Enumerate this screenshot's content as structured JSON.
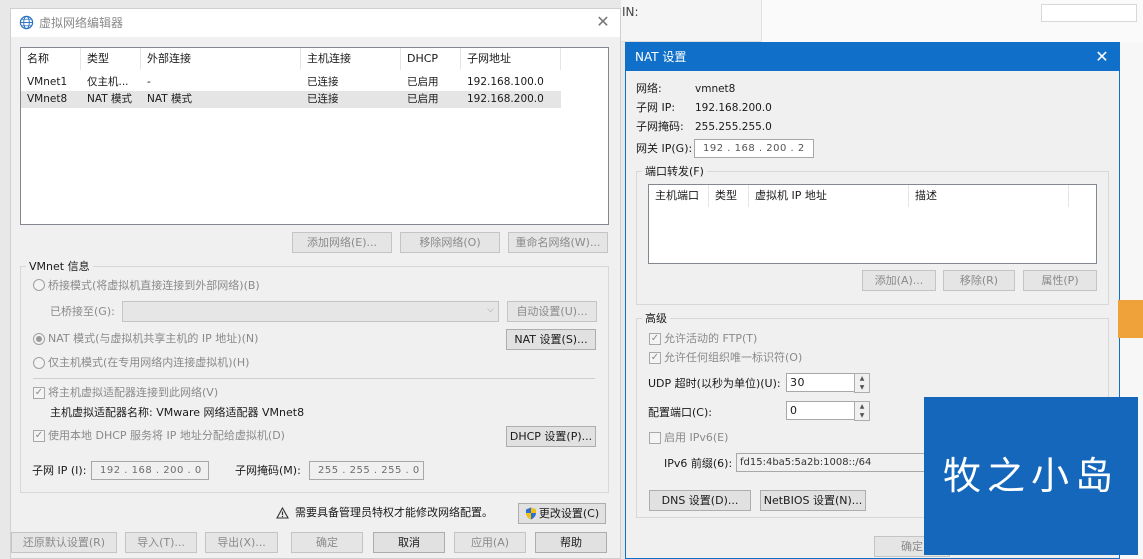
{
  "main": {
    "title": "虚拟网络编辑器",
    "table": {
      "headers": [
        "名称",
        "类型",
        "外部连接",
        "主机连接",
        "DHCP",
        "子网地址"
      ],
      "rows": [
        [
          "VMnet1",
          "仅主机...",
          "-",
          "已连接",
          "已启用",
          "192.168.100.0"
        ],
        [
          "VMnet8",
          "NAT 模式",
          "NAT 模式",
          "已连接",
          "已启用",
          "192.168.200.0"
        ]
      ]
    },
    "buttons": {
      "add_network": "添加网络(E)...",
      "remove_network": "移除网络(O)",
      "rename_network": "重命名网络(W)..."
    },
    "vmnet_info": {
      "group_label": "VMnet 信息",
      "bridge_mode": "桥接模式(将虚拟机直接连接到外部网络)(B)",
      "bridged_to": "已桥接至(G):",
      "auto_settings": "自动设置(U)...",
      "nat_mode": "NAT 模式(与虚拟机共享主机的 IP 地址)(N)",
      "nat_settings": "NAT 设置(S)...",
      "host_only": "仅主机模式(在专用网络内连接虚拟机)(H)",
      "connect_adapter": "将主机虚拟适配器连接到此网络(V)",
      "adapter_name": "主机虚拟适配器名称: VMware 网络适配器 VMnet8",
      "use_dhcp": "使用本地 DHCP 服务将 IP 地址分配给虚拟机(D)",
      "dhcp_settings": "DHCP 设置(P)...",
      "subnet_ip_label": "子网 IP (I):",
      "subnet_ip": "192 . 168 . 200 .  0",
      "subnet_mask_label": "子网掩码(M):",
      "subnet_mask": "255 . 255 . 255 .  0"
    },
    "admin_notice": "需要具备管理员特权才能修改网络配置。",
    "change_settings": "更改设置(C)",
    "footer": {
      "restore_defaults": "还原默认设置(R)",
      "import": "导入(T)...",
      "export": "导出(X)...",
      "ok": "确定",
      "cancel": "取消",
      "apply": "应用(A)",
      "help": "帮助"
    }
  },
  "background": {
    "partial_text": "IN:"
  },
  "nat": {
    "title": "NAT 设置",
    "network_label": "网络:",
    "network": "vmnet8",
    "subnet_ip_label": "子网 IP:",
    "subnet_ip": "192.168.200.0",
    "subnet_mask_label": "子网掩码:",
    "subnet_mask": "255.255.255.0",
    "gateway_label": "网关 IP(G):",
    "gateway": "192 . 168 . 200 .  2",
    "port_forwarding": {
      "label": "端口转发(F)",
      "headers": [
        "主机端口",
        "类型",
        "虚拟机 IP 地址",
        "描述"
      ],
      "add": "添加(A)...",
      "remove": "移除(R)",
      "properties": "属性(P)"
    },
    "advanced": {
      "label": "高级",
      "allow_ftp": "允许活动的 FTP(T)",
      "allow_org_id": "允许任何组织唯一标识符(O)",
      "udp_timeout_label": "UDP 超时(以秒为单位)(U):",
      "udp_timeout": "30",
      "config_port_label": "配置端口(C):",
      "config_port": "0",
      "enable_ipv6": "启用 IPv6(E)",
      "ipv6_prefix_label": "IPv6 前缀(6):",
      "ipv6_prefix": "fd15:4ba5:5a2b:1008::/64",
      "dns_settings": "DNS 设置(D)...",
      "netbios_settings": "NetBIOS 设置(N)..."
    },
    "ok": "确定"
  },
  "watermark": {
    "text": "牧之小岛"
  }
}
